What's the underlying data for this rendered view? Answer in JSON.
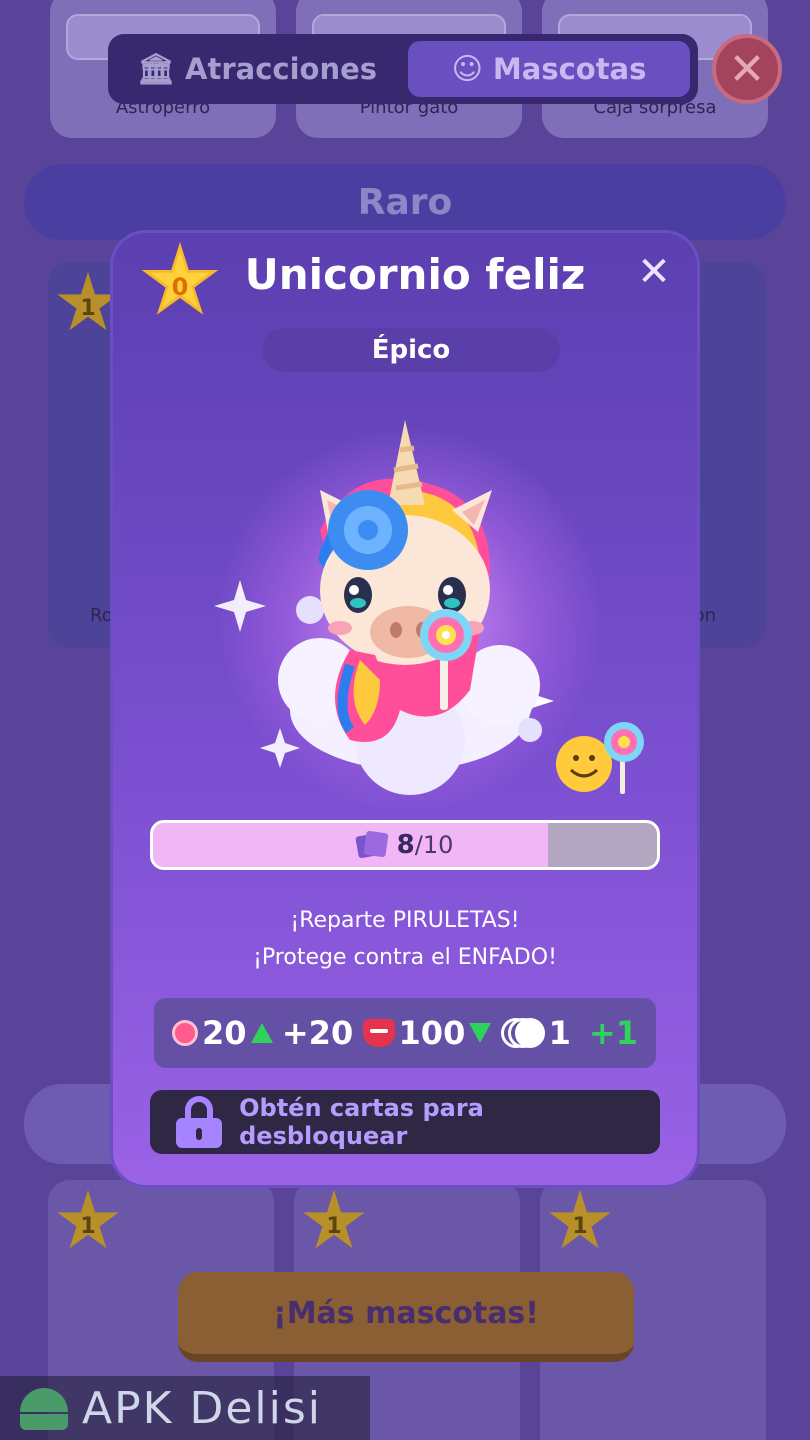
{
  "header": {
    "tabs": [
      {
        "label": "Atracciones",
        "icon": "attraction-building-icon",
        "active": false
      },
      {
        "label": "Mascotas",
        "icon": "pet-clown-icon",
        "active": true
      }
    ]
  },
  "background": {
    "top_cards": [
      {
        "label": "Astroperro"
      },
      {
        "label": "Pintor gato"
      },
      {
        "label": "Caja sorpresa"
      }
    ],
    "section_title": "Raro",
    "middle_cards": [
      {
        "level": "1",
        "label": "Ro"
      },
      {
        "level": "",
        "label": "on"
      }
    ],
    "bottom_cards": [
      {
        "level": "1"
      },
      {
        "level": "1"
      },
      {
        "level": "1"
      }
    ],
    "more_pets_label": "¡Más mascotas!",
    "watermark": "APK Delisi"
  },
  "modal": {
    "level": "0",
    "title": "Unicornio feliz",
    "rarity": "Épico",
    "progress": {
      "current": "8",
      "total": "/10",
      "fraction": 0.8
    },
    "description_line1": "¡Reparte PIRULETAS!",
    "description_line2": "¡Protege contra el ENFADO!",
    "stats": {
      "happiness": "20",
      "happiness_bonus": "+20",
      "anger": "100",
      "coins": "1",
      "coins_bonus": "+1"
    },
    "unlock_label": "Obtén cartas para desbloquear"
  },
  "colors": {
    "modal_top": "#5b3fb0",
    "modal_bottom": "#9b62e6",
    "star": "#ffd23d",
    "progress_fill": "#f0b6f6",
    "green": "#2fd35a",
    "lock": "#a684ff"
  }
}
